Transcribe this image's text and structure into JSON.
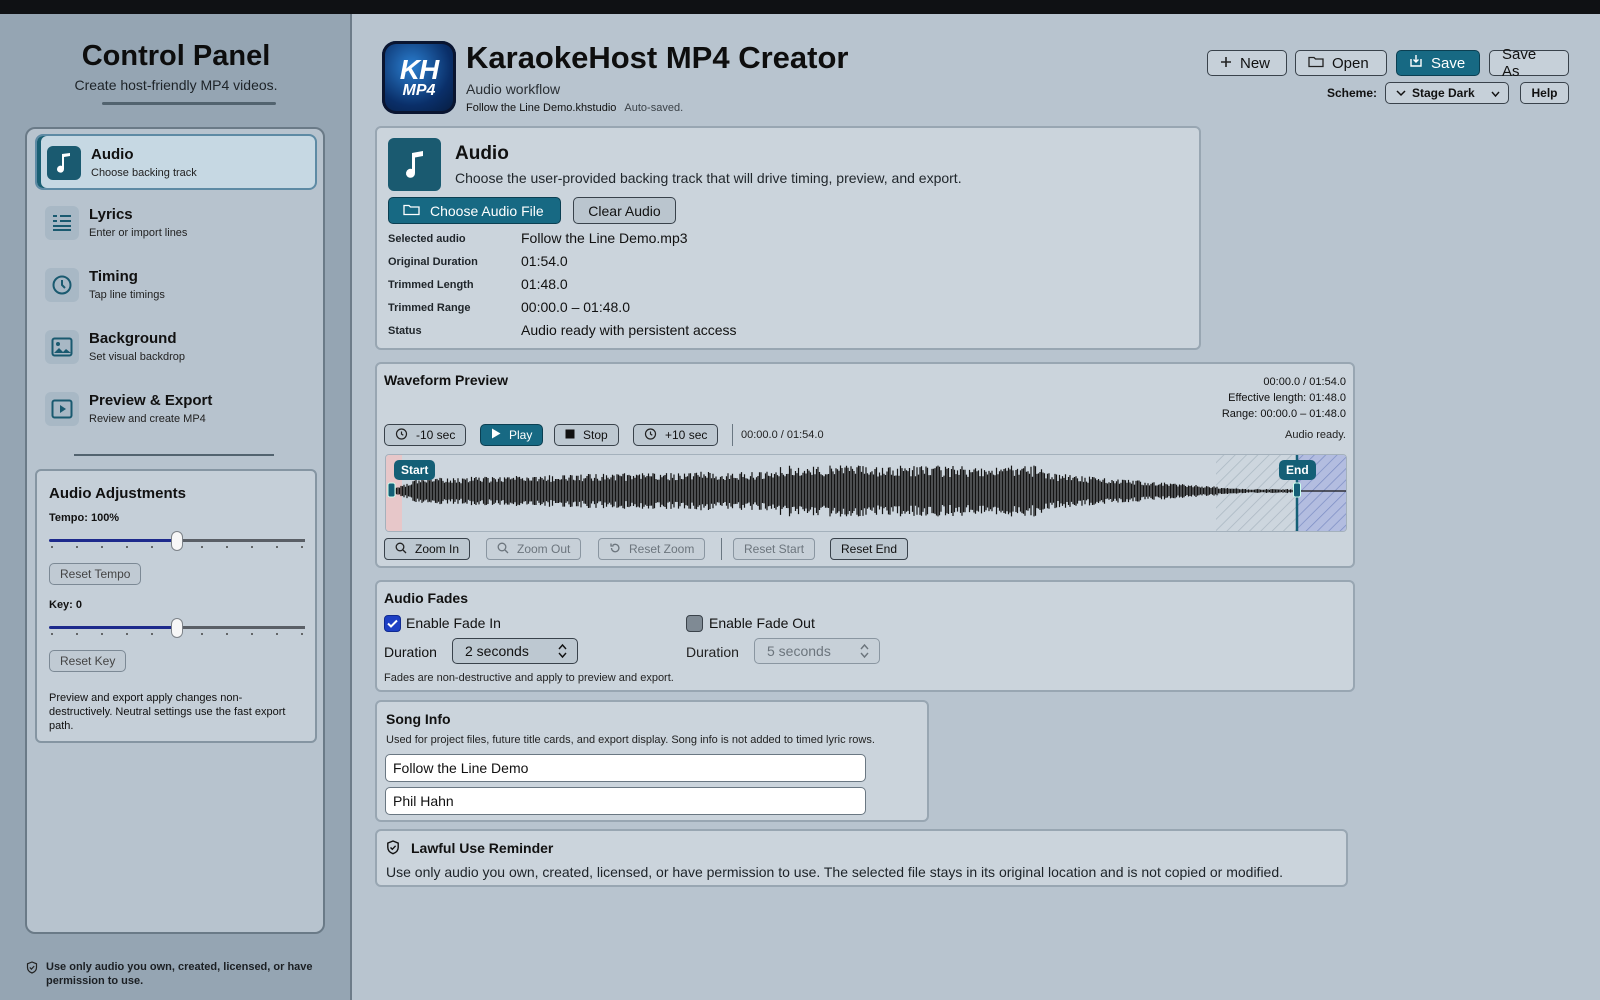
{
  "sidebar": {
    "title": "Control Panel",
    "subtitle": "Create host-friendly MP4 videos.",
    "items": [
      {
        "label": "Audio",
        "desc": "Choose backing track",
        "icon": "music-note-icon",
        "active": true
      },
      {
        "label": "Lyrics",
        "desc": "Enter or import lines",
        "icon": "lyrics-list-icon"
      },
      {
        "label": "Timing",
        "desc": "Tap line timings",
        "icon": "timer-icon"
      },
      {
        "label": "Background",
        "desc": "Set visual backdrop",
        "icon": "image-icon"
      },
      {
        "label": "Preview & Export",
        "desc": "Review and create MP4",
        "icon": "play-box-icon"
      }
    ],
    "adjustments": {
      "title": "Audio Adjustments",
      "tempo_label": "Tempo: 100%",
      "tempo_value": 0.5,
      "reset_tempo": "Reset Tempo",
      "key_label": "Key: 0",
      "key_value": 0.5,
      "reset_key": "Reset Key",
      "note": "Preview and export apply changes non-destructively. Neutral settings use the fast export path."
    },
    "footer": "Use only audio you own, created, licensed, or have permission to use."
  },
  "header": {
    "logo_line1": "KH",
    "logo_line2": "MP4",
    "title": "KaraokeHost MP4 Creator",
    "subtitle": "Audio workflow",
    "filename": "Follow the Line Demo.khstudio",
    "saved": "Auto-saved.",
    "buttons": {
      "new": "New",
      "open": "Open",
      "save": "Save",
      "save_as": "Save As",
      "help": "Help"
    },
    "scheme_label": "Scheme:",
    "scheme_value": "Stage Dark"
  },
  "audio": {
    "heading": "Audio",
    "description": "Choose the user-provided backing track that will drive timing, preview, and export.",
    "choose_label": "Choose Audio File",
    "clear_label": "Clear Audio",
    "fields": [
      {
        "key": "Selected audio",
        "value": "Follow the Line Demo.mp3"
      },
      {
        "key": "Original Duration",
        "value": "01:54.0"
      },
      {
        "key": "Trimmed Length",
        "value": "01:48.0"
      },
      {
        "key": "Trimmed Range",
        "value": "00:00.0 – 01:48.0"
      },
      {
        "key": "Status",
        "value": "Audio ready with persistent access"
      }
    ]
  },
  "waveform": {
    "heading": "Waveform Preview",
    "meta_time": "00:00.0 / 01:54.0",
    "meta_effective": "Effective length: 01:48.0",
    "meta_range": "Range: 00:00.0 – 01:48.0",
    "back_label": "-10 sec",
    "play_label": "Play",
    "stop_label": "Stop",
    "fwd_label": "+10 sec",
    "position": "00:00.0 / 01:54.0",
    "status": "Audio ready.",
    "start_marker": "Start",
    "end_marker": "End",
    "zoom_in": "Zoom In",
    "zoom_out": "Zoom Out",
    "reset_zoom": "Reset Zoom",
    "reset_start": "Reset Start",
    "reset_end": "Reset End"
  },
  "fades": {
    "heading": "Audio Fades",
    "fade_in_label": "Enable Fade In",
    "fade_in_checked": true,
    "fade_out_label": "Enable Fade Out",
    "fade_out_checked": false,
    "duration_label": "Duration",
    "fade_in_duration": "2 seconds",
    "fade_out_duration": "5 seconds",
    "note": "Fades are non-destructive and apply to preview and export."
  },
  "song_info": {
    "heading": "Song Info",
    "description": "Used for project files, future title cards, and export display. Song info is not added to timed lyric rows.",
    "title_value": "Follow the Line Demo",
    "artist_value": "Phil Hahn"
  },
  "lawful": {
    "heading": "Lawful Use Reminder",
    "text": "Use only audio you own, created, licensed, or have permission to use. The selected file stays in its original location and is not copied or modified."
  },
  "colors": {
    "accent": "#176983",
    "accent_dark": "#1a5a70",
    "checkbox": "#1d3fc4",
    "background": "#b8c4cf",
    "sidebar": "#95a5b3"
  }
}
